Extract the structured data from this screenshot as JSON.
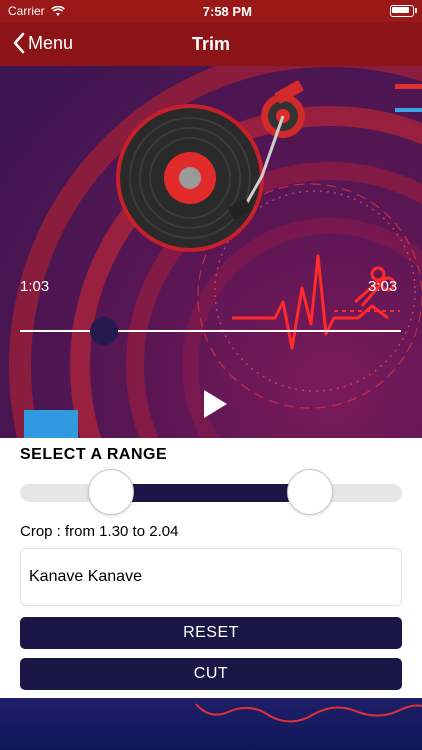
{
  "status": {
    "carrier": "Carrier",
    "time": "7:58 PM",
    "icons": [
      "wifi-icon",
      "battery-icon"
    ]
  },
  "nav": {
    "back_label": "Menu",
    "title": "Trim"
  },
  "player": {
    "current_time": "1:03",
    "duration": "3:03",
    "progress": 0.22
  },
  "range": {
    "title": "SELECT A RANGE",
    "start_fraction": 0.24,
    "end_fraction": 0.76,
    "crop_text": "Crop : from 1.30 to 2.04"
  },
  "song_name": {
    "value": "Kanave Kanave"
  },
  "buttons": {
    "reset": "RESET",
    "cut": "CUT"
  },
  "colors": {
    "accent": "#1b1645",
    "hero_red": "#e0202a",
    "nav_bg": "#8c1416"
  }
}
